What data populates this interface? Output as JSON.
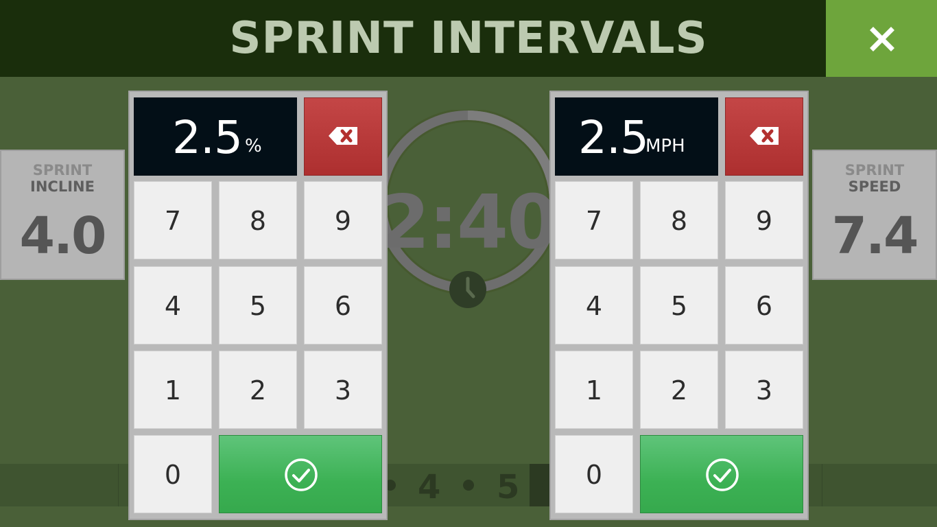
{
  "header": {
    "title": "SPRINT INTERVALS",
    "close_icon": "close-icon"
  },
  "timer": {
    "time": "2:40",
    "progress": 0.25,
    "icon": "clock-icon"
  },
  "interval_strip": {
    "visible_numbers": [
      "4",
      "5"
    ]
  },
  "left_card": {
    "label_line1": "SPRINT",
    "label_line2": "INCLINE",
    "value": "4.0"
  },
  "right_card": {
    "label_line1": "SPRINT",
    "label_line2": "SPEED",
    "value": "7.4"
  },
  "incline_keypad": {
    "display_value": "2.5",
    "display_unit": "%",
    "backspace_icon": "backspace-icon",
    "keys": [
      "7",
      "8",
      "9",
      "4",
      "5",
      "6",
      "1",
      "2",
      "3",
      "0"
    ],
    "confirm_icon": "check-circle-icon"
  },
  "speed_keypad": {
    "display_value": "2.5",
    "display_unit": "MPH",
    "backspace_icon": "backspace-icon",
    "keys": [
      "7",
      "8",
      "9",
      "4",
      "5",
      "6",
      "1",
      "2",
      "3",
      "0"
    ],
    "confirm_icon": "check-circle-icon"
  },
  "colors": {
    "header_bg": "#1a2e0c",
    "close_bg": "#6ea53c",
    "backspace_red": "#b93a3a",
    "confirm_green": "#3cb154",
    "page_bg": "#4a6038"
  }
}
